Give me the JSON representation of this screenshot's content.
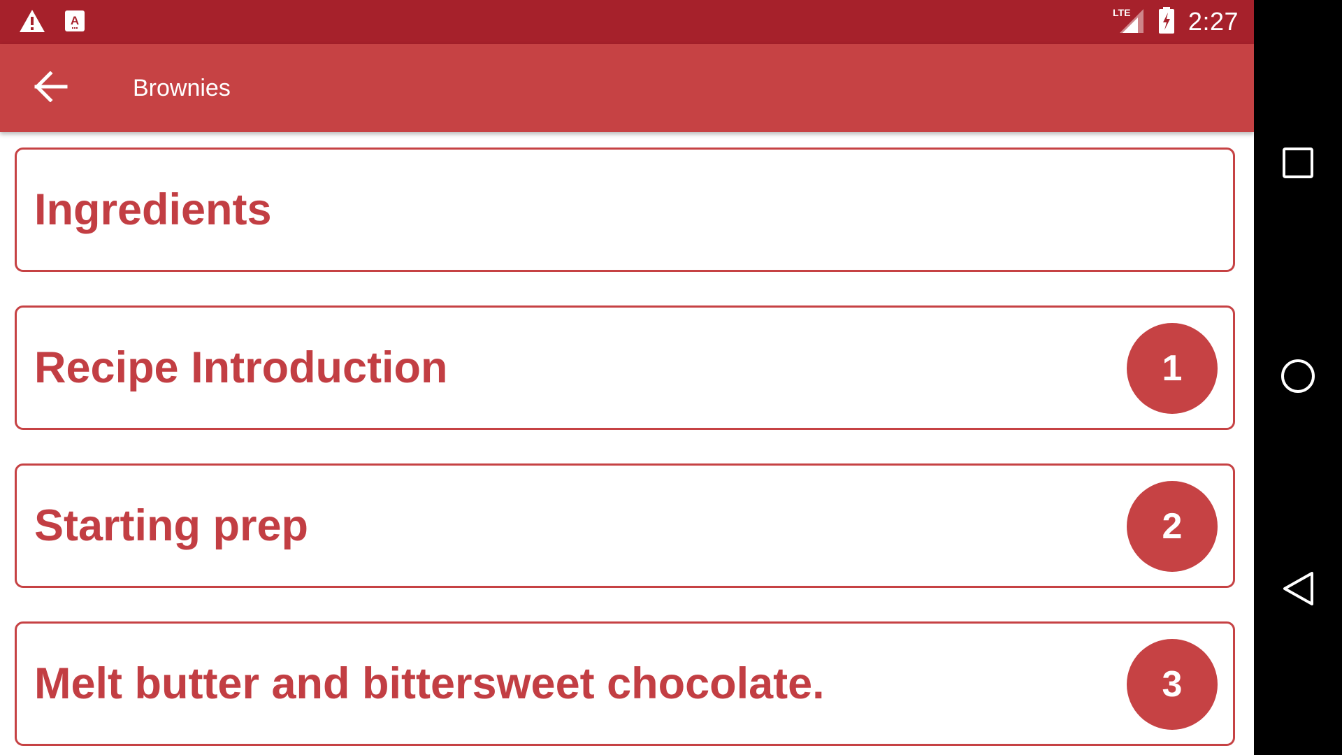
{
  "status_bar": {
    "time": "2:27",
    "network_label": "LTE",
    "icons": [
      "warning-icon",
      "text-a-icon",
      "lte-signal-icon",
      "battery-charging-icon"
    ]
  },
  "app_bar": {
    "title": "Brownies",
    "back_icon": "arrow-back-icon"
  },
  "items": [
    {
      "label": "Ingredients",
      "step": ""
    },
    {
      "label": "Recipe Introduction",
      "step": "1"
    },
    {
      "label": "Starting prep",
      "step": "2"
    },
    {
      "label": "Melt butter and bittersweet chocolate.",
      "step": "3"
    }
  ],
  "nav_bar": {
    "icons": [
      "recents-square-icon",
      "home-circle-icon",
      "back-triangle-icon"
    ]
  },
  "colors": {
    "status_bar": "#a6212b",
    "app_bar": "#c64244",
    "accent_text": "#c23e43",
    "card_border": "#c64244",
    "badge_fill": "#c64244",
    "nav_bar": "#000000"
  }
}
